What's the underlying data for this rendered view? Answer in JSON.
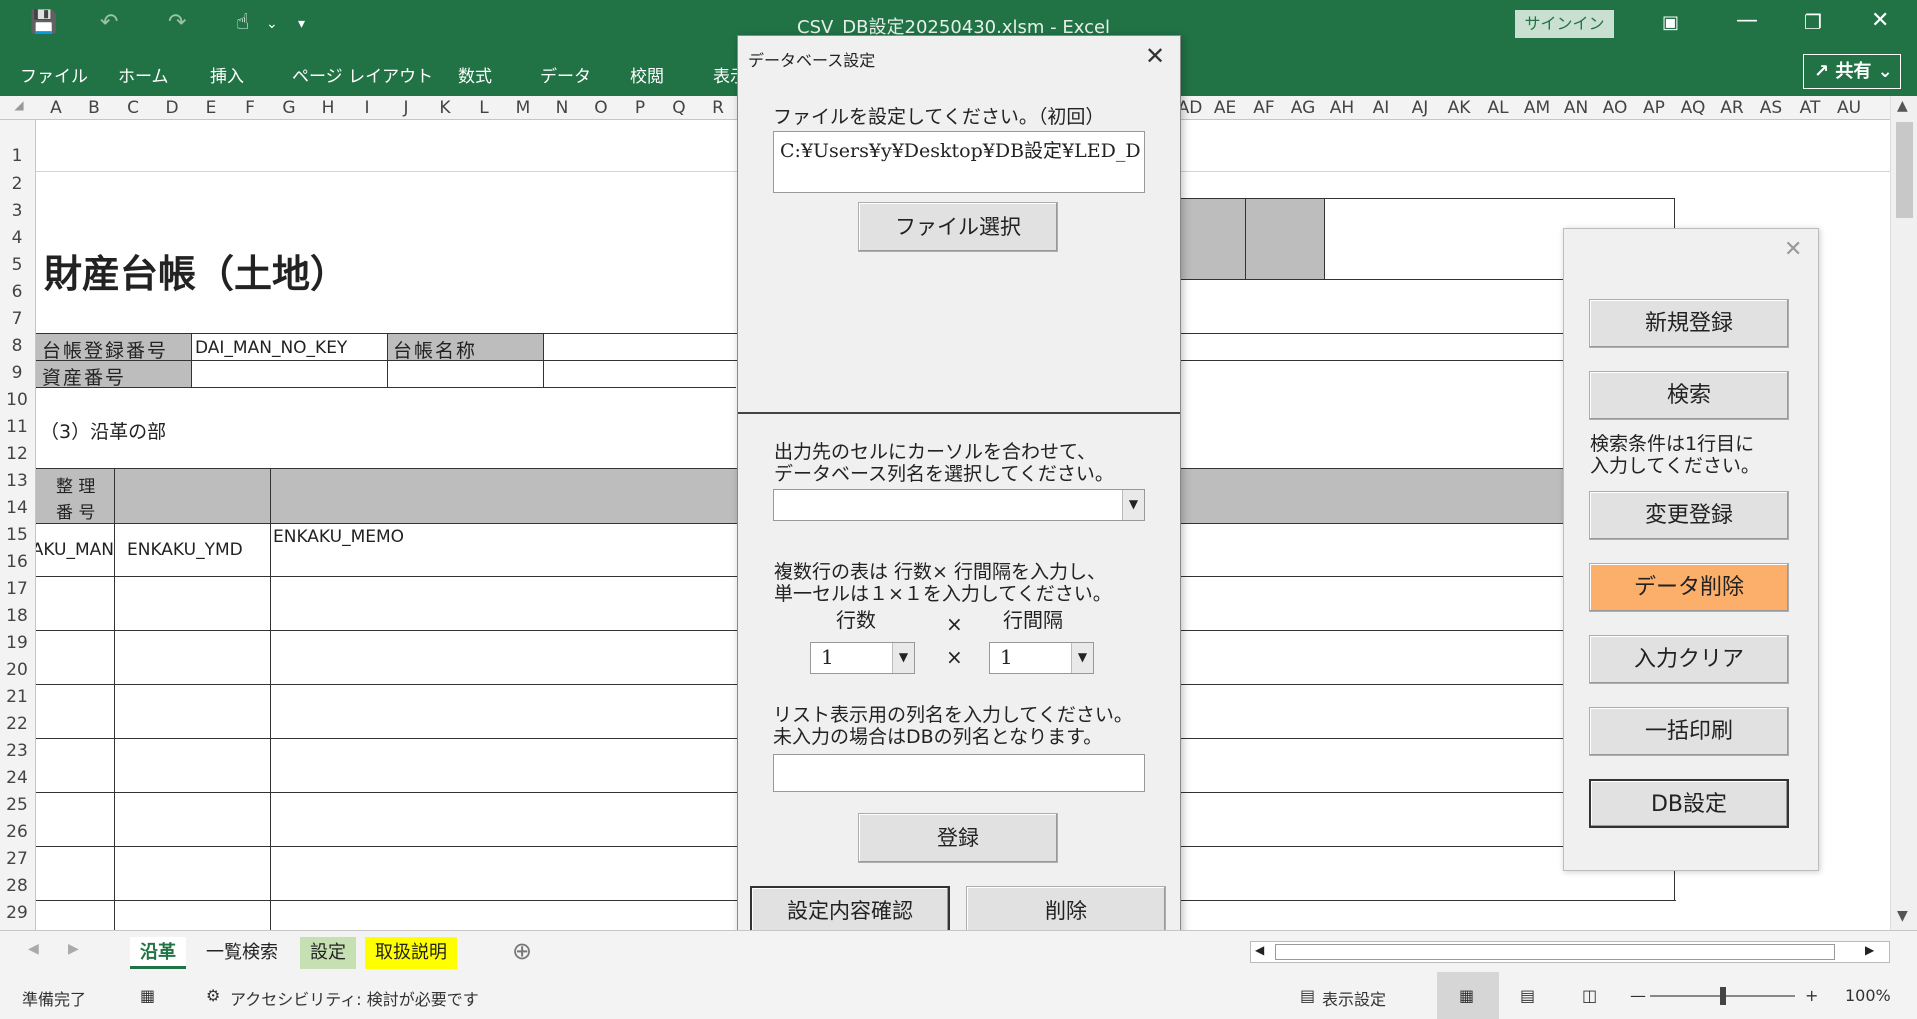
{
  "titlebar": {
    "title": "CSV_DB設定20250430.xlsm  -  Excel",
    "signin": "サインイン",
    "share": "共有"
  },
  "ribbon": {
    "tabs": [
      "ファイル",
      "ホーム",
      "挿入",
      "ページ レイアウト",
      "数式",
      "データ",
      "校閲",
      "表示"
    ]
  },
  "columns": [
    "A",
    "B",
    "C",
    "D",
    "E",
    "F",
    "G",
    "H",
    "I",
    "J",
    "K",
    "L",
    "M",
    "N",
    "O",
    "P",
    "Q",
    "R",
    "AD",
    "AE",
    "AF",
    "AG",
    "AH",
    "AI",
    "AJ",
    "AK",
    "AL",
    "AM",
    "AN",
    "AO",
    "AP",
    "AQ",
    "AR",
    "AS",
    "AT",
    "AU"
  ],
  "rows": [
    "1",
    "2",
    "3",
    "4",
    "5",
    "6",
    "7",
    "8",
    "9",
    "10",
    "11",
    "12",
    "13",
    "14",
    "15",
    "16",
    "17",
    "18",
    "19",
    "20",
    "21",
    "22",
    "23",
    "24",
    "25",
    "26",
    "27",
    "28",
    "29"
  ],
  "sheet": {
    "title": "財産台帳（土地）",
    "ledger_label": "台帳登録番号",
    "ledger_value": "DAI_MAN_NO_KEY",
    "ledger_name_label": "台帳名称",
    "asset_label": "資産番号",
    "section": "（3）沿革の部",
    "hdr_no_1": "整 理",
    "hdr_no_2": "番 号",
    "c1": "AKU_MAN",
    "c2": "ENKAKU_YMD",
    "c3": "ENKAKU_MEMO"
  },
  "dialog": {
    "title": "データベース設定",
    "file_label": "ファイルを設定してください。（初回）",
    "file_path": "C:¥Users¥y¥Desktop¥DB設定¥LED_D",
    "file_button": "ファイル選択",
    "cursor_label": "出力先のセルにカーソルを合わせて、\nデータベース列名を選択してください。",
    "multi_label": "複数行の表は 行数× 行間隔を入力し、\n単一セルは１×１を入力してください。",
    "rows_label": "行数",
    "times": "×",
    "interval_label": "行間隔",
    "rows_value": "1",
    "interval_value": "1",
    "list_label": "リスト表示用の列名を入力してください。\n未入力の場合はDBの列名となります。",
    "register_button": "登録",
    "confirm_button": "設定内容確認",
    "delete_button": "削除"
  },
  "panel": {
    "new_button": "新規登録",
    "search_button": "検索",
    "search_note": "検索条件は1行目に\n入力してください。",
    "change_button": "変更登録",
    "delete_data_button": "データ削除",
    "clear_button": "入力クリア",
    "print_button": "一括印刷",
    "db_button": "DB設定"
  },
  "sheettabs": [
    "沿革",
    "一覧検索",
    "設定",
    "取扱説明"
  ],
  "status": {
    "ready": "準備完了",
    "accessibility": "アクセシビリティ: 検討が必要です",
    "display": "表示設定",
    "zoom": "100%"
  },
  "colors": {
    "excel_green": "#217346",
    "orange_button": "#fcaf6b",
    "yellow_tab": "#ffff00"
  }
}
